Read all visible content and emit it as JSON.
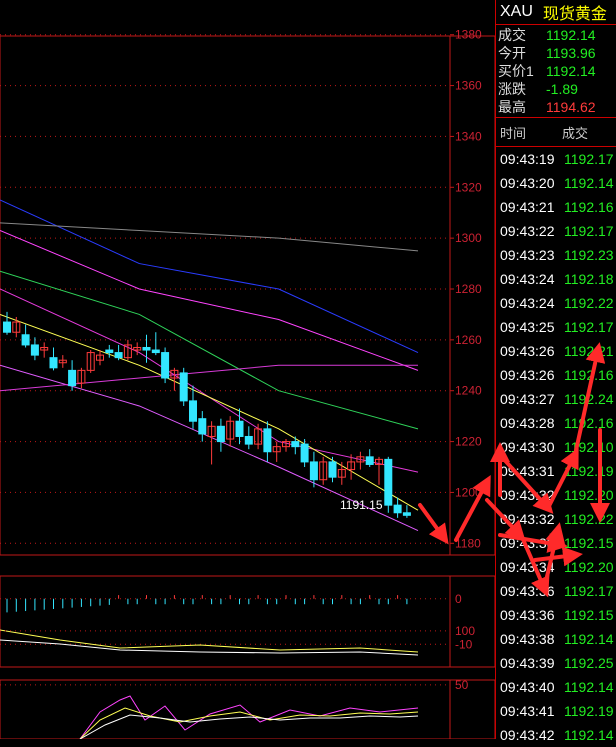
{
  "header": {
    "symbol": "XAU",
    "name": "现货黄金"
  },
  "quotes": [
    {
      "key": "成交",
      "value": "1192.14",
      "color": "#22ee22"
    },
    {
      "key": "今开",
      "value": "1193.96",
      "color": "#22ee22"
    },
    {
      "key": "买价1",
      "value": "1192.14",
      "color": "#22ee22"
    },
    {
      "key": "涨跌",
      "value": "-1.89",
      "color": "#22ee22"
    },
    {
      "key": "最高",
      "value": "1194.62",
      "color": "#ff3b3b"
    }
  ],
  "ticks_header": {
    "time": "时间",
    "price": "成交"
  },
  "ticks": [
    {
      "time": "09:43:19",
      "price": "1192.17"
    },
    {
      "time": "09:43:20",
      "price": "1192.14"
    },
    {
      "time": "09:43:21",
      "price": "1192.16"
    },
    {
      "time": "09:43:22",
      "price": "1192.17"
    },
    {
      "time": "09:43:23",
      "price": "1192.23"
    },
    {
      "time": "09:43:24",
      "price": "1192.18"
    },
    {
      "time": "09:43:24",
      "price": "1192.22"
    },
    {
      "time": "09:43:25",
      "price": "1192.17"
    },
    {
      "time": "09:43:26",
      "price": "1192.21"
    },
    {
      "time": "09:43:26",
      "price": "1192.16"
    },
    {
      "time": "09:43:27",
      "price": "1192.24"
    },
    {
      "time": "09:43:28",
      "price": "1192.16"
    },
    {
      "time": "09:43:30",
      "price": "1192.10"
    },
    {
      "time": "09:43:31",
      "price": "1192.19"
    },
    {
      "time": "09:43:32",
      "price": "1192.20"
    },
    {
      "time": "09:43:32",
      "price": "1192.22"
    },
    {
      "time": "09:43:33",
      "price": "1192.15"
    },
    {
      "time": "09:43:34",
      "price": "1192.20"
    },
    {
      "time": "09:43:36",
      "price": "1192.17"
    },
    {
      "time": "09:43:36",
      "price": "1192.15"
    },
    {
      "time": "09:43:38",
      "price": "1192.14"
    },
    {
      "time": "09:43:39",
      "price": "1192.25"
    },
    {
      "time": "09:43:40",
      "price": "1192.14"
    },
    {
      "time": "09:43:41",
      "price": "1192.19"
    },
    {
      "time": "09:43:42",
      "price": "1192.14"
    }
  ],
  "chart_data": {
    "type": "candlestick",
    "ylim": [
      1175,
      1385
    ],
    "yticks": [
      1180,
      1200,
      1220,
      1240,
      1260,
      1280,
      1300,
      1320,
      1340,
      1360,
      1380
    ],
    "last_price_label": "1191.15",
    "colors": {
      "up": "#ff3b3b",
      "down": "#33e6ff",
      "axis": "#c01818"
    },
    "candles": [
      [
        1267,
        1271,
        1262,
        1263
      ],
      [
        1263,
        1269,
        1261,
        1267
      ],
      [
        1262,
        1266,
        1257,
        1258
      ],
      [
        1258,
        1261,
        1252,
        1254
      ],
      [
        1256,
        1259,
        1253,
        1257
      ],
      [
        1253,
        1257,
        1248,
        1249
      ],
      [
        1251,
        1254,
        1249,
        1252
      ],
      [
        1248,
        1252,
        1240,
        1242
      ],
      [
        1243,
        1249,
        1241,
        1248
      ],
      [
        1248,
        1256,
        1247,
        1255
      ],
      [
        1252,
        1256,
        1250,
        1254
      ],
      [
        1256,
        1258,
        1253,
        1255
      ],
      [
        1255,
        1258,
        1252,
        1253
      ],
      [
        1253,
        1260,
        1252,
        1258
      ],
      [
        1256,
        1259,
        1254,
        1257
      ],
      [
        1257,
        1262,
        1251,
        1256
      ],
      [
        1256,
        1263,
        1254,
        1255
      ],
      [
        1255,
        1257,
        1243,
        1245
      ],
      [
        1245,
        1249,
        1240,
        1248
      ],
      [
        1247,
        1249,
        1234,
        1236
      ],
      [
        1236,
        1242,
        1225,
        1228
      ],
      [
        1229,
        1232,
        1220,
        1223
      ],
      [
        1222,
        1228,
        1211,
        1226
      ],
      [
        1226,
        1229,
        1216,
        1220
      ],
      [
        1221,
        1230,
        1218,
        1228
      ],
      [
        1228,
        1233,
        1219,
        1222
      ],
      [
        1222,
        1226,
        1217,
        1219
      ],
      [
        1219,
        1227,
        1217,
        1225
      ],
      [
        1225,
        1228,
        1212,
        1216
      ],
      [
        1216,
        1220,
        1212,
        1218
      ],
      [
        1218,
        1221,
        1216,
        1220
      ],
      [
        1220,
        1222,
        1215,
        1218
      ],
      [
        1219,
        1221,
        1210,
        1212
      ],
      [
        1212,
        1216,
        1202,
        1205
      ],
      [
        1205,
        1214,
        1203,
        1212
      ],
      [
        1212,
        1214,
        1204,
        1206
      ],
      [
        1206,
        1212,
        1203,
        1209
      ],
      [
        1209,
        1215,
        1205,
        1212
      ],
      [
        1212,
        1216,
        1209,
        1214
      ],
      [
        1214,
        1217,
        1210,
        1211
      ],
      [
        1211,
        1214,
        1203,
        1213
      ],
      [
        1213,
        1214,
        1192,
        1195
      ],
      [
        1195,
        1198,
        1190,
        1192
      ],
      [
        1192,
        1195,
        1190,
        1191
      ]
    ],
    "lines": [
      {
        "color": "#2a3cff",
        "values": [
          1315,
          1290,
          1280,
          1255
        ]
      },
      {
        "color": "#888888",
        "values": [
          1306,
          1303,
          1300,
          1295
        ]
      },
      {
        "color": "#ff44ff",
        "values": [
          1303,
          1280,
          1268,
          1248
        ]
      },
      {
        "color": "#2fd35a",
        "values": [
          1287,
          1270,
          1240,
          1225
        ]
      },
      {
        "color": "#e63bdc",
        "values": [
          1280,
          1255,
          1220,
          1208
        ]
      },
      {
        "color": "#ffff55",
        "values": [
          1270,
          1250,
          1225,
          1193
        ]
      },
      {
        "color": "#e05cff",
        "values": [
          1250,
          1234,
          1210,
          1185
        ]
      },
      {
        "color": "#d83bd8",
        "values": [
          1240,
          1245,
          1250,
          1250
        ]
      }
    ],
    "macd": {
      "ylim": [
        -15,
        5
      ],
      "yticks": [
        0,
        -10
      ]
    },
    "kdj": {
      "ylim": [
        0,
        110
      ],
      "yticks": [
        100,
        50
      ]
    }
  }
}
